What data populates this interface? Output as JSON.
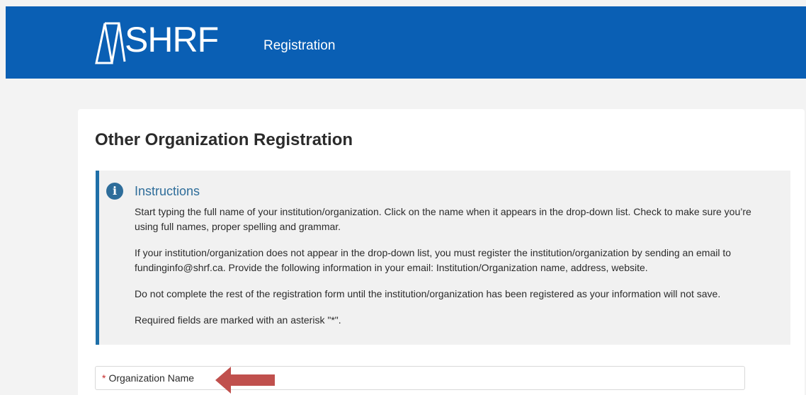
{
  "header": {
    "logo_text": "SHRF",
    "title": "Registration",
    "background_color": "#0a5fb4"
  },
  "main": {
    "page_title": "Other Organization Registration",
    "instructions": {
      "icon": "info-icon",
      "icon_glyph": "i",
      "heading": "Instructions",
      "paragraphs": [
        "Start typing the full name of your institution/organization. Click on the name when it appears in the drop-down list. Check to make sure you’re using full names, proper spelling and grammar.",
        "If your institution/organization does not appear in the drop-down list, you must register the institution/organization by sending an email to fundinginfo@shrf.ca. Provide the following information in your email: Institution/Organization name, address, website.",
        "Do not complete the rest of the registration form until the institution/organization has been registered as your information will not save.",
        "Required fields are marked with an asterisk \"*\"."
      ],
      "accent_color": "#1e6fa8"
    },
    "organization_field": {
      "required_marker": "*",
      "label": "Organization Name",
      "required_color": "#c62828"
    },
    "annotation": {
      "icon": "arrow-left-icon",
      "color": "#c0504d"
    }
  }
}
